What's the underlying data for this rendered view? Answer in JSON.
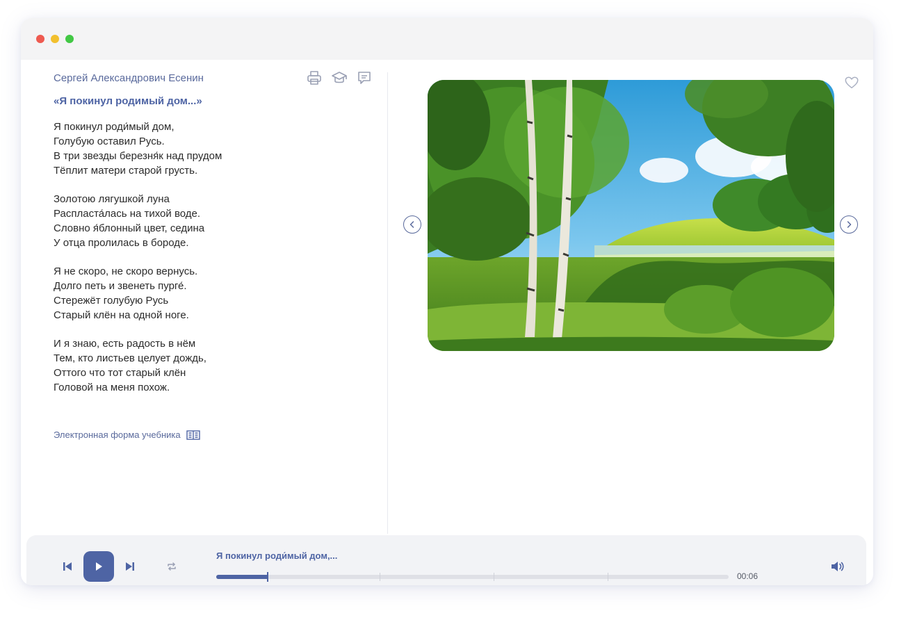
{
  "poem": {
    "author": "Сергей Александрович Есенин",
    "title": "«Я покинул родимый дом...»",
    "stanzas": [
      [
        "Я покинул роди́мый дом,",
        "Голубую оставил Русь.",
        "В три звезды березня́к над прудом",
        "Тёплит матери старой грусть."
      ],
      [
        "Золотою лягушкой луна",
        "Распласта́лась на тихой воде.",
        "Словно я́блонный цвет, седина",
        "У отца пролилась в бороде."
      ],
      [
        "Я не скоро, не скоро вернусь.",
        "Долго петь и звенеть пурге́.",
        "Стережёт голубую Русь",
        "Старый клён на одной ноге."
      ],
      [
        "И я знаю, есть радость в нём",
        "Тем, кто листьев целует дождь,",
        "Оттого что тот старый клён",
        "Головой на меня похож."
      ]
    ],
    "ebook_link": "Электронная форма учебника"
  },
  "toolbar_icons": [
    "print-icon",
    "graduation-cap-icon",
    "comment-icon"
  ],
  "gallery": {
    "image_subject": "birch-trees-by-pond-landscape",
    "favorite_icon": "heart-icon"
  },
  "player": {
    "track_title": "Я покинул роди́мый дом,...",
    "time": "00:06",
    "progress": 0.1,
    "icons": [
      "skip-back-icon",
      "play-icon",
      "skip-forward-icon",
      "repeat-icon",
      "volume-icon"
    ]
  },
  "colors": {
    "accent": "#4e64a4",
    "link": "#5a6a9c",
    "text": "#2b2b2b",
    "player_bg": "#f2f3f6"
  }
}
